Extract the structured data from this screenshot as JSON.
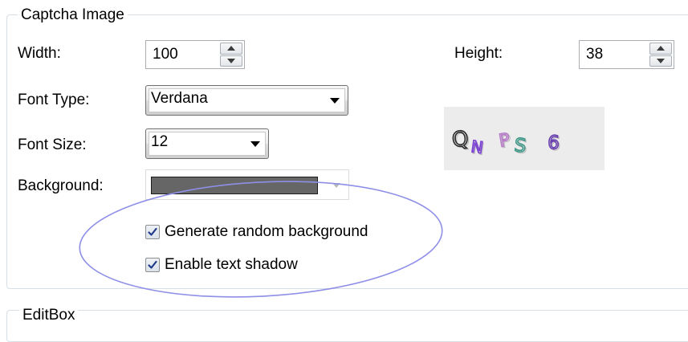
{
  "captcha_group": {
    "title": "Captcha Image",
    "width": {
      "label": "Width:",
      "value": "100"
    },
    "height": {
      "label": "Height:",
      "value": "38"
    },
    "font_type": {
      "label": "Font Type:",
      "value": "Verdana"
    },
    "font_size": {
      "label": "Font Size:",
      "value": "12"
    },
    "background": {
      "label": "Background:",
      "color": "#666666"
    },
    "random_background": {
      "label": "Generate random background",
      "checked": true
    },
    "text_shadow": {
      "label": "Enable text shadow",
      "checked": true
    },
    "preview": {
      "chars": [
        {
          "c": "Q",
          "color": "#2b2b2b"
        },
        {
          "c": "N",
          "color": "#7a3fd2"
        },
        {
          "c": "P",
          "color": "#b77cc9"
        },
        {
          "c": "S",
          "color": "#3f9a8a"
        },
        {
          "c": "6",
          "color": "#6a3fb0"
        }
      ]
    }
  },
  "editbox_group": {
    "title": "EditBox"
  },
  "colors": {
    "group_border": "#d5dfe5",
    "annotation": "#8f8fe8"
  }
}
